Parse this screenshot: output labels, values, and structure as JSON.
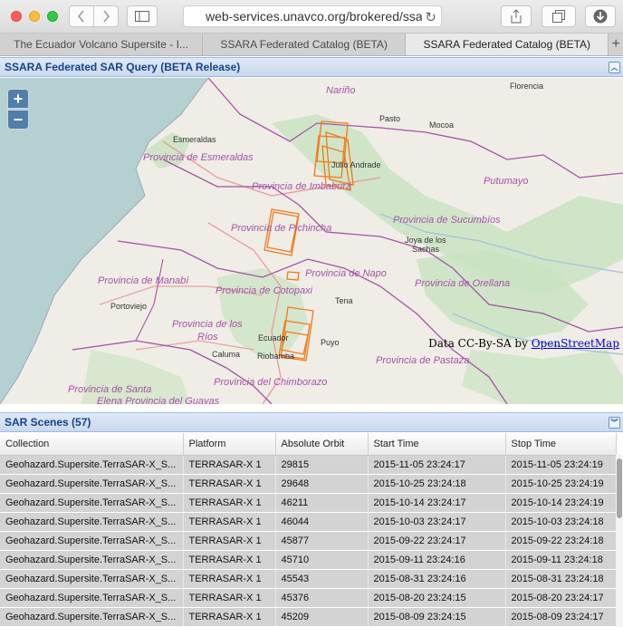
{
  "browser": {
    "url": "web-services.unavco.org/brokered/ssara",
    "tabs": [
      {
        "label": "The Ecuador Volcano Supersite - I..."
      },
      {
        "label": "SSARA Federated Catalog (BETA)"
      },
      {
        "label": "SSARA Federated Catalog (BETA)"
      }
    ],
    "new_tab": "+"
  },
  "map_panel": {
    "title": "SSARA Federated SAR Query (BETA Release)",
    "zoom_in": "+",
    "zoom_out": "−",
    "attribution_prefix": "Data CC-By-SA by ",
    "attribution_link": "OpenStreetMap",
    "provinces": [
      "Nariño",
      "Provincia de Esmeraldas",
      "Provincia de Imbabura",
      "Putumayo",
      "Provincia de Sucumbíos",
      "Provincia de Pichincha",
      "Provincia de Napo",
      "Provincia de Manabí",
      "Provincia de Orellana",
      "Provincia de Cotopaxi",
      "Provincia de los",
      "Ríos",
      "Provincia de Pastaza",
      "Provincia del Chimborazo",
      "Provincia de Santa",
      "Elena Provincia del Guayas"
    ],
    "cities": [
      "Florencia",
      "Pasto",
      "Mocoa",
      "Esmeraldas",
      "Julio Andrade",
      "Joya de los",
      "Sachas",
      "Portoviejo",
      "Tena",
      "Ecuador",
      "Puyo",
      "Caluma",
      "Riobamba"
    ]
  },
  "scenes_panel": {
    "title": "SAR Scenes (57)",
    "columns": [
      "Collection",
      "Platform",
      "Absolute Orbit",
      "Start Time",
      "Stop Time"
    ],
    "rows": [
      [
        "Geohazard.Supersite.TerraSAR-X_S...",
        "TERRASAR-X 1",
        "29815",
        "2015-11-05 23:24:17",
        "2015-11-05 23:24:19"
      ],
      [
        "Geohazard.Supersite.TerraSAR-X_S...",
        "TERRASAR-X 1",
        "29648",
        "2015-10-25 23:24:18",
        "2015-10-25 23:24:19"
      ],
      [
        "Geohazard.Supersite.TerraSAR-X_S...",
        "TERRASAR-X 1",
        "46211",
        "2015-10-14 23:24:17",
        "2015-10-14 23:24:19"
      ],
      [
        "Geohazard.Supersite.TerraSAR-X_S...",
        "TERRASAR-X 1",
        "46044",
        "2015-10-03 23:24:17",
        "2015-10-03 23:24:18"
      ],
      [
        "Geohazard.Supersite.TerraSAR-X_S...",
        "TERRASAR-X 1",
        "45877",
        "2015-09-22 23:24:17",
        "2015-09-22 23:24:18"
      ],
      [
        "Geohazard.Supersite.TerraSAR-X_S...",
        "TERRASAR-X 1",
        "45710",
        "2015-09-11 23:24:16",
        "2015-09-11 23:24:18"
      ],
      [
        "Geohazard.Supersite.TerraSAR-X_S...",
        "TERRASAR-X 1",
        "45543",
        "2015-08-31 23:24:16",
        "2015-08-31 23:24:18"
      ],
      [
        "Geohazard.Supersite.TerraSAR-X_S...",
        "TERRASAR-X 1",
        "45376",
        "2015-08-20 23:24:15",
        "2015-08-20 23:24:17"
      ],
      [
        "Geohazard.Supersite.TerraSAR-X_S...",
        "TERRASAR-X 1",
        "45209",
        "2015-08-09 23:24:15",
        "2015-08-09 23:24:17"
      ]
    ]
  },
  "colors": {
    "footprint": "#f07a1a",
    "province_border": "#a453a6",
    "header_text": "#15428b",
    "ocean": "#b5d0d0",
    "park": "#c8e2c0"
  }
}
